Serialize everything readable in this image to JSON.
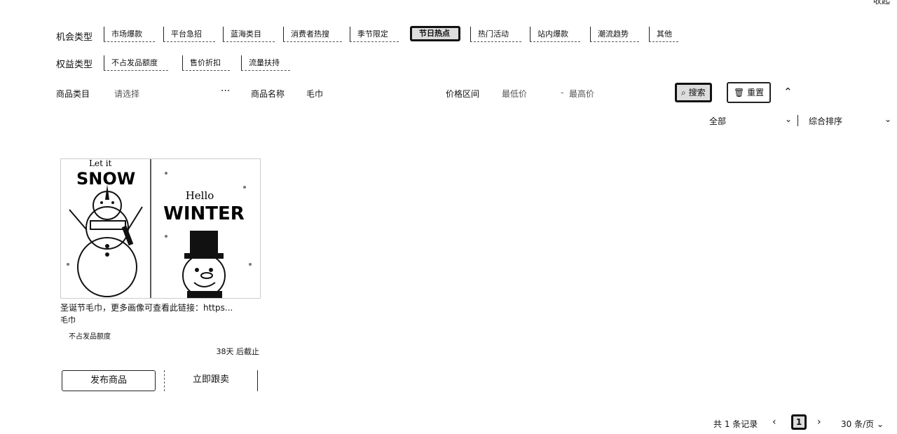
{
  "top_right_label": "收起",
  "opportunity": {
    "label": "机会类型",
    "tags": [
      "市场爆款",
      "平台急招",
      "蓝海类目",
      "消费者热搜",
      "季节限定",
      "节日热点",
      "热门活动",
      "站内爆款",
      "潮流趋势",
      "其他"
    ],
    "active_index": 5
  },
  "benefit": {
    "label": "权益类型",
    "tags": [
      "不占发品额度",
      "售价折扣",
      "流量扶持"
    ]
  },
  "filters": {
    "category_label": "商品类目",
    "category_placeholder": "请选择",
    "name_label": "商品名称",
    "name_value": "毛巾",
    "price_label": "价格区间",
    "price_min_placeholder": "最低价",
    "price_dash": "-",
    "price_max_placeholder": "最高价",
    "search_label": "搜索",
    "reset_label": "重置"
  },
  "sort": {
    "scope": "全部",
    "order": "综合排序"
  },
  "card": {
    "image_left_line1": "Let it",
    "image_left_line2": "SNOW",
    "image_right_line1": "Hello",
    "image_right_line2": "WINTER",
    "title": "圣诞节毛巾，更多画像可查看此链接：https...",
    "category": "毛巾",
    "benefit_tag": "不占发品额度",
    "deadline": "38天 后截止",
    "publish_label": "发布商品",
    "follow_label": "立即跟卖"
  },
  "pagination": {
    "total_text": "共 1 条记录",
    "current_page": "1",
    "page_size": "30 条/页"
  },
  "colors": {
    "text": "#111111",
    "border": "#222222",
    "active_bg": "#dddddd"
  }
}
